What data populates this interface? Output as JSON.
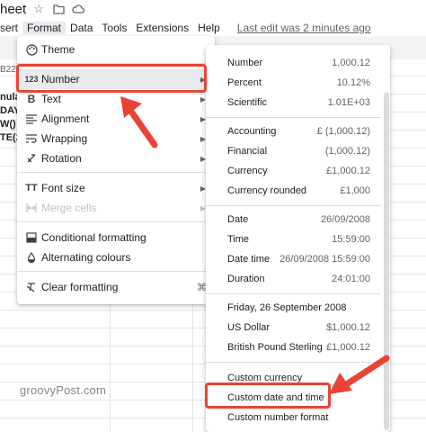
{
  "app": {
    "doc_title_fragment": "heet",
    "title_icons": [
      "star-icon",
      "folder-move-icon",
      "cloud-icon"
    ]
  },
  "menubar": {
    "items": [
      "sert",
      "Format",
      "Data",
      "Tools",
      "Extensions",
      "Help"
    ],
    "active": "Format",
    "last_edit": "Last edit was 2 minutes ago"
  },
  "sheet": {
    "namebox": "B22",
    "cell_fragments": [
      "nula",
      "DAY(",
      "W()",
      "TE(2"
    ]
  },
  "format_menu": {
    "items": [
      {
        "icon": "palette-icon",
        "label": "Theme",
        "submenu": false
      },
      {
        "icon": "number-123-icon",
        "label": "Number",
        "submenu": true,
        "highlighted": true
      },
      {
        "icon": "bold-text-icon",
        "label": "Text",
        "submenu": true
      },
      {
        "icon": "align-icon",
        "label": "Alignment",
        "submenu": true
      },
      {
        "icon": "wrap-icon",
        "label": "Wrapping",
        "submenu": true
      },
      {
        "icon": "rotation-icon",
        "label": "Rotation",
        "submenu": true
      },
      {
        "icon": "font-size-icon",
        "label": "Font size",
        "submenu": true
      },
      {
        "icon": "merge-cells-icon",
        "label": "Merge cells",
        "submenu": true,
        "disabled": true
      },
      {
        "icon": "conditional-format-icon",
        "label": "Conditional formatting",
        "submenu": false
      },
      {
        "icon": "fill-drop-icon",
        "label": "Alternating colours",
        "submenu": false
      },
      {
        "icon": "clear-format-icon",
        "label": "Clear formatting",
        "submenu": false,
        "shortcut": "⌘\\"
      }
    ]
  },
  "number_menu": {
    "groups": [
      [
        {
          "label": "Number",
          "value": "1,000.12"
        },
        {
          "label": "Percent",
          "value": "10.12%"
        },
        {
          "label": "Scientific",
          "value": "1.01E+03"
        }
      ],
      [
        {
          "label": "Accounting",
          "value": "£ (1,000.12)"
        },
        {
          "label": "Financial",
          "value": "(1,000.12)"
        },
        {
          "label": "Currency",
          "value": "£1,000.12"
        },
        {
          "label": "Currency rounded",
          "value": "£1,000"
        }
      ],
      [
        {
          "label": "Date",
          "value": "26/09/2008"
        },
        {
          "label": "Time",
          "value": "15:59:00"
        },
        {
          "label": "Date time",
          "value": "26/09/2008 15:59:00"
        },
        {
          "label": "Duration",
          "value": "24:01:00"
        }
      ],
      [
        {
          "label": "Friday, 26 September 2008",
          "value": ""
        },
        {
          "label": "US Dollar",
          "value": "$1,000.12"
        },
        {
          "label": "British Pound Sterling",
          "value": "£1,000.12"
        }
      ],
      [
        {
          "label": "Custom currency",
          "value": ""
        },
        {
          "label": "Custom date and time",
          "value": "",
          "highlighted": true
        },
        {
          "label": "Custom number format",
          "value": ""
        }
      ]
    ]
  },
  "annotations": {
    "color": "#ea4335"
  },
  "watermark": "groovyPost.com"
}
